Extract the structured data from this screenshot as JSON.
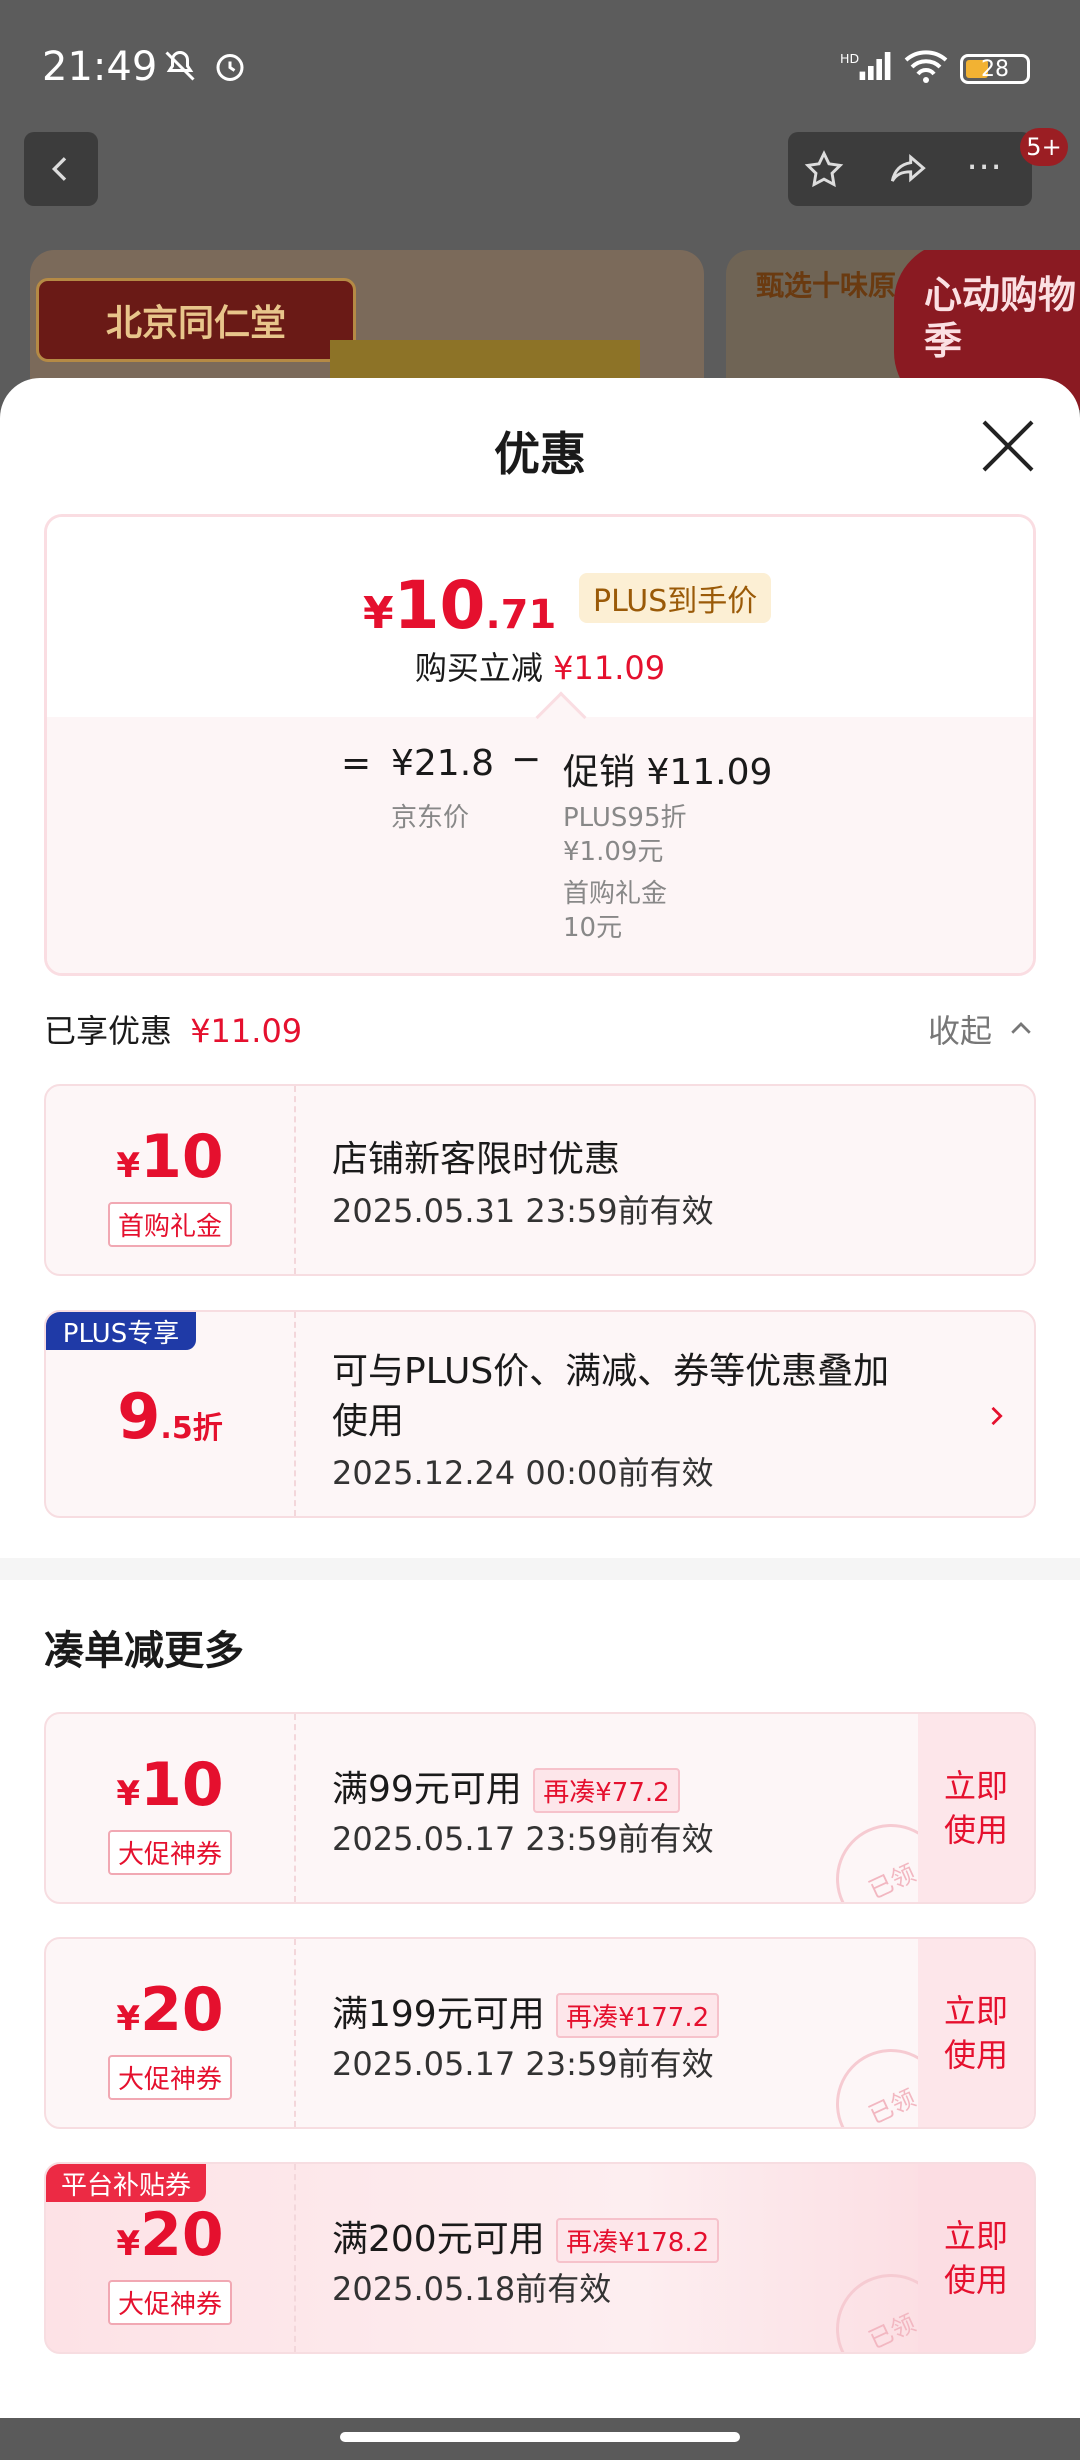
{
  "status": {
    "time": "21:49",
    "battery": "28",
    "network": "HD"
  },
  "nav": {
    "badge": "5+"
  },
  "banners": {
    "left_brand": "北京同仁堂",
    "right_text": "甄选十味原",
    "promo": "心动购物季"
  },
  "sheet": {
    "title": "优惠",
    "price": {
      "currency": "¥",
      "int": "10",
      "dec": ".71",
      "plus_tag": "PLUS到手价",
      "save_label": "购买立减",
      "save_value": "¥11.09"
    },
    "calc": {
      "eq": "=",
      "jd_price": "¥21.8",
      "jd_label": "京东价",
      "minus": "−",
      "promo_label": "促销",
      "promo_value": "¥11.09",
      "detail1": "PLUS95折",
      "detail1_val": "¥1.09元",
      "detail2": "首购礼金",
      "detail2_val": "10元"
    },
    "enjoyed": {
      "label": "已享优惠",
      "value": "¥11.09",
      "collapse": "收起"
    },
    "coupons_enjoyed": [
      {
        "currency": "¥",
        "amount": "10",
        "tag": "首购礼金",
        "title": "店铺新客限时优惠",
        "expiry": "2025.05.31 23:59前有效"
      },
      {
        "corner": "PLUS专享",
        "amount": "9",
        "amount_dec": ".5折",
        "title_line1": "可与PLUS价、满减、券等优惠叠加",
        "title_line2": "使用",
        "expiry": "2025.12.24 00:00前有效"
      }
    ],
    "more": {
      "title": "凑单减更多"
    },
    "coupons_more": [
      {
        "currency": "¥",
        "amount": "10",
        "tag": "大促神券",
        "title": "满99元可用",
        "chip": "再凑¥77.2",
        "expiry": "2025.05.17 23:59前有效",
        "button": "立即\n使用",
        "stamp": "已领"
      },
      {
        "currency": "¥",
        "amount": "20",
        "tag": "大促神券",
        "title": "满199元可用",
        "chip": "再凑¥177.2",
        "expiry": "2025.05.17 23:59前有效",
        "button": "立即\n使用",
        "stamp": "已领"
      },
      {
        "corner": "平台补贴券",
        "currency": "¥",
        "amount": "20",
        "tag": "大促神券",
        "title": "满200元可用",
        "chip": "再凑¥178.2",
        "expiry": "2025.05.18前有效",
        "button": "立即\n使用",
        "stamp": "已领"
      }
    ]
  }
}
